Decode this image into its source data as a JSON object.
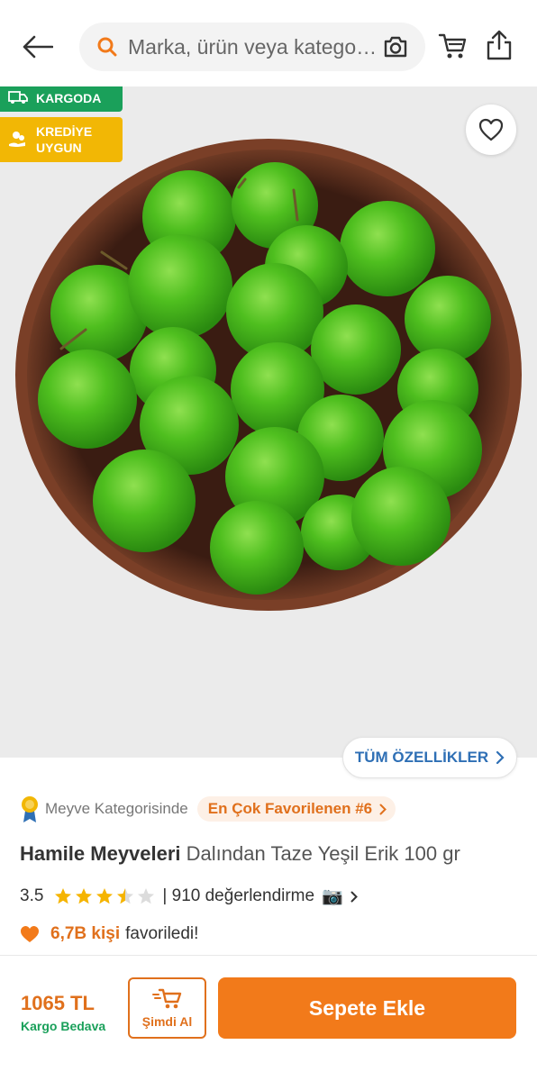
{
  "header": {
    "search_placeholder": "Marka, ürün veya katego…"
  },
  "badges": {
    "cargo_label": "KARGODA",
    "credit_label_line1": "KREDİYE",
    "credit_label_line2": "UYGUN"
  },
  "specs_button": {
    "label": "TÜM ÖZELLİKLER"
  },
  "category": {
    "text": "Meyve Kategorisinde",
    "pill_label": "En Çok Favorilenen #6"
  },
  "product": {
    "brand": "Hamile Meyveleri",
    "name": "Dalından Taze Yeşil Erik 100 gr",
    "rating_score": "3.5",
    "rating_value": 3.5,
    "rating_max": 5,
    "review_count": "| 910 değerlendirme",
    "favorite_count": "6,7B kişi",
    "favorite_suffix": "favoriledi!"
  },
  "purchase": {
    "price": "1065 TL",
    "cargo_text": "Kargo Bedava",
    "buy_now_label": "Şimdi Al",
    "add_to_cart_label": "Sepete Ekle"
  },
  "colors": {
    "accent": "#f27a1a",
    "accent_text": "#e0701c",
    "green": "#1aa05a",
    "yellow": "#f2b705",
    "link_blue": "#2e6fb5",
    "star": "#f5b400"
  }
}
